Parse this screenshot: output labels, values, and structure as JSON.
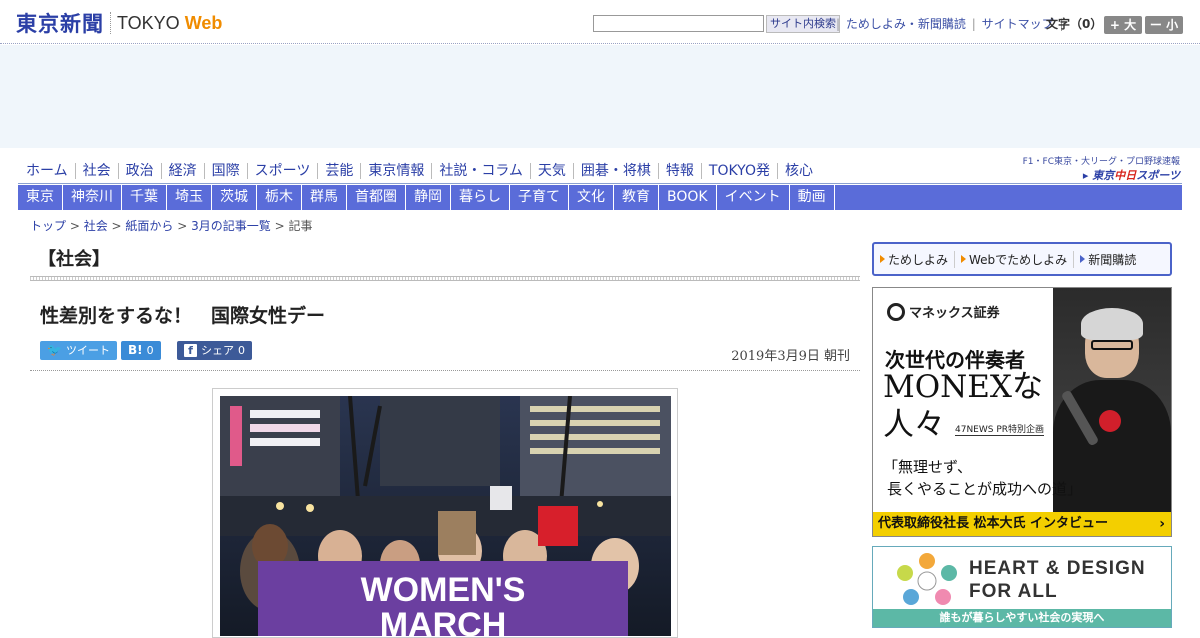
{
  "header": {
    "logo_main": "東京新聞",
    "logo_tokyo": "TOKYO",
    "logo_web": "Web",
    "search_button": "サイト内検索",
    "links": [
      "ためしよみ・新聞購読",
      "サイトマップ"
    ],
    "font_label": "文字（0）",
    "font_plus": "+ 大",
    "font_minus": "ー 小"
  },
  "nav_primary": [
    "ホーム",
    "社会",
    "政治",
    "経済",
    "国際",
    "スポーツ",
    "芸能",
    "東京情報",
    "社説・コラム",
    "天気",
    "囲碁・将棋",
    "特報",
    "TOKYO発",
    "核心"
  ],
  "sports_link": {
    "top": "F1・FC東京・大リーグ・プロ野球速報",
    "bottom_prefix": "▸ 東京",
    "bottom_red": "中日",
    "bottom_suffix": "スポーツ"
  },
  "nav_secondary": [
    "東京",
    "神奈川",
    "千葉",
    "埼玉",
    "茨城",
    "栃木",
    "群馬",
    "首都圏",
    "静岡",
    "暮らし",
    "子育て",
    "文化",
    "教育",
    "BOOK",
    "イベント",
    "動画"
  ],
  "breadcrumb": [
    "トップ",
    "社会",
    "紙面から",
    "3月の記事一覧",
    "記事"
  ],
  "article": {
    "section": "【社会】",
    "headline": "性差別をするな！　国際女性デー",
    "share_tweet": "ツイート",
    "share_hatena": "B!",
    "share_hatena_count": "0",
    "share_fb": "シェア",
    "share_fb_count": "0",
    "date": "2019年3月9日 朝刊",
    "photo_banner_line1": "WOMEN'S",
    "photo_banner_line2": "MARCH"
  },
  "subscribe": [
    "ためしよみ",
    "Webでためしよみ",
    "新聞購読"
  ],
  "ad_monex": {
    "logo": "マネックス証券",
    "headline1": "次世代の伴奏者",
    "headline2": "MONEXな",
    "headline3": "人々",
    "tag": "47NEWS PR特別企画",
    "quote1": "「無理せず、",
    "quote2": "長くやることが成功への道」",
    "bottom": "代表取締役社長 松本大氏 インタビュー",
    "bottom_arrow": "›"
  },
  "ad_heart": {
    "line1": "HEART & DESIGN",
    "line2": "FOR ALL",
    "bar": "誰もが暮らしやすい社会の実現へ"
  }
}
